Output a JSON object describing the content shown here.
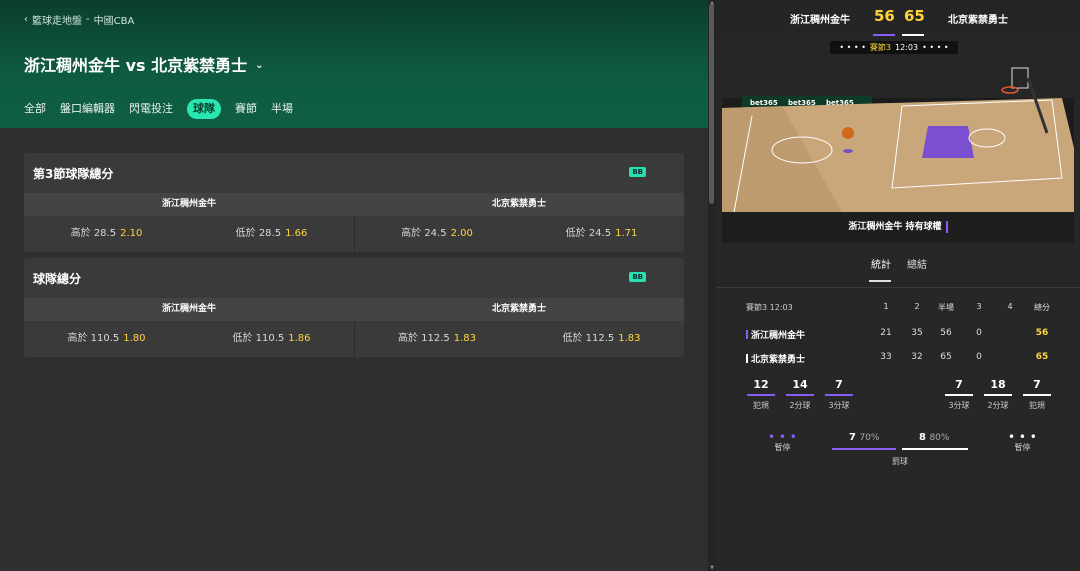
{
  "breadcrumb": {
    "back": "籃球走地盤",
    "sep": "-",
    "league": "中國CBA"
  },
  "match": {
    "title": "浙江稠州金牛 vs 北京紫禁勇士",
    "chevron": "⌄"
  },
  "tabs": [
    "全部",
    "盤口編輯器",
    "閃電投注",
    "球隊",
    "賽節",
    "半場"
  ],
  "active_tab": "球隊",
  "cards": [
    {
      "title": "第3節球隊總分",
      "badge": "BB",
      "teams": [
        "浙江稠州金牛",
        "北京紫禁勇士"
      ],
      "odds": [
        {
          "label": "高於 28.5",
          "price": "2.10"
        },
        {
          "label": "低於 28.5",
          "price": "1.66"
        },
        {
          "label": "高於 24.5",
          "price": "2.00"
        },
        {
          "label": "低於 24.5",
          "price": "1.71"
        }
      ]
    },
    {
      "title": "球隊總分",
      "badge": "BB",
      "teams": [
        "浙江稠州金牛",
        "北京紫禁勇士"
      ],
      "odds": [
        {
          "label": "高於 110.5",
          "price": "1.80"
        },
        {
          "label": "低於 110.5",
          "price": "1.86"
        },
        {
          "label": "高於 112.5",
          "price": "1.83"
        },
        {
          "label": "低於 112.5",
          "price": "1.83"
        }
      ]
    }
  ],
  "scoreboard": {
    "home": "浙江稠州金牛",
    "home_score": "56",
    "away_score": "65",
    "away": "北京紫禁勇士"
  },
  "court": {
    "period_label": "賽節3",
    "clock": "12:03",
    "dots": "• • • •",
    "sponsor": "bet365",
    "possession": "浙江稠州金牛  持有球權"
  },
  "stat_tabs": [
    "統計",
    "總結"
  ],
  "box_score": {
    "header": {
      "label": "賽節3",
      "clock": "12:03",
      "cols": [
        "1",
        "2",
        "半場",
        "3",
        "4",
        "總分"
      ]
    },
    "rows": [
      {
        "team": "浙江稠州金牛",
        "vals": [
          "21",
          "35",
          "56",
          "0",
          "",
          "56"
        ]
      },
      {
        "team": "北京紫禁勇士",
        "vals": [
          "33",
          "32",
          "65",
          "0",
          "",
          "65"
        ]
      }
    ]
  },
  "team_stats": {
    "home": [
      {
        "value": "12",
        "label": "犯規"
      },
      {
        "value": "14",
        "label": "2分球"
      },
      {
        "value": "7",
        "label": "3分球"
      }
    ],
    "away": [
      {
        "value": "7",
        "label": "3分球"
      },
      {
        "value": "18",
        "label": "2分球"
      },
      {
        "value": "7",
        "label": "犯規"
      }
    ]
  },
  "free_throws": {
    "home_made": "7",
    "home_pct": "70%",
    "away_made": "8",
    "away_pct": "80%",
    "label": "罰球",
    "timeout_label": "暫停",
    "timeout_dots": "• • •"
  },
  "colors": {
    "home": "#8a5cf6",
    "away": "#ffffff",
    "price": "#ffd43b",
    "accent": "#29e6b3"
  }
}
